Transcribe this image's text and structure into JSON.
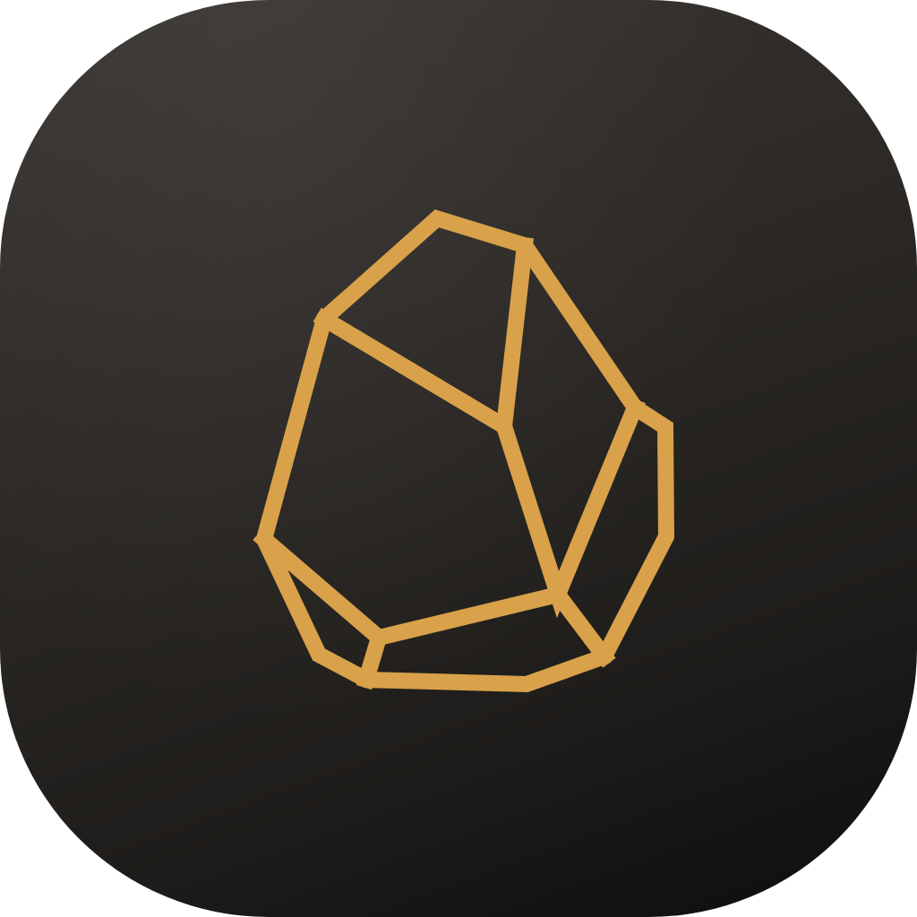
{
  "app_icon": {
    "label": "",
    "symbol": "rock-icon",
    "background_top": "#3a3632",
    "background_bottom": "#0e0d0c",
    "accent": "#d8a14a"
  }
}
